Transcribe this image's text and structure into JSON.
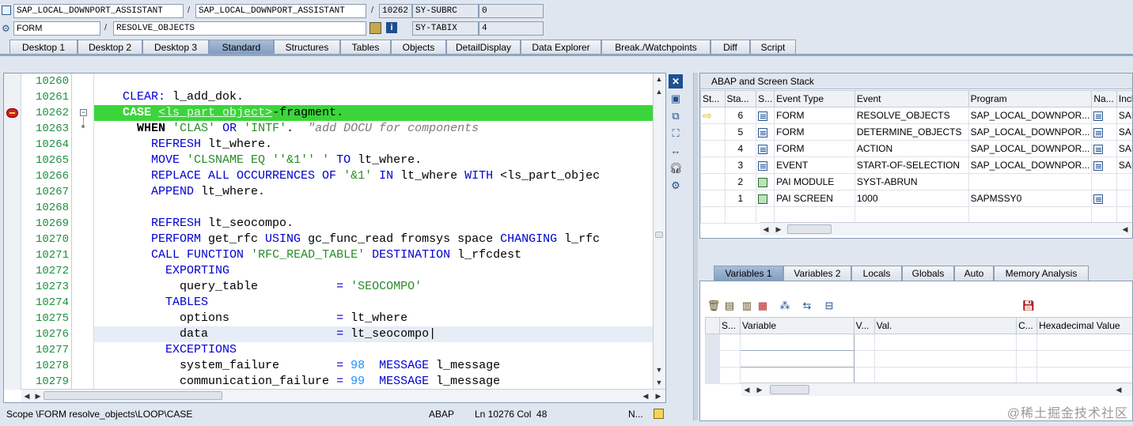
{
  "header": {
    "program1": "SAP_LOCAL_DOWNPORT_ASSISTANT",
    "program2": "SAP_LOCAL_DOWNPORT_ASSISTANT",
    "line_no": "10262",
    "subrc_label": "SY-SUBRC",
    "subrc_value": "0",
    "event_type": "FORM",
    "event_name": "RESOLVE_OBJECTS",
    "tabix_label": "SY-TABIX",
    "tabix_value": "4",
    "slash": "/"
  },
  "tabs": [
    "Desktop 1",
    "Desktop 2",
    "Desktop 3",
    "Standard",
    "Structures",
    "Tables",
    "Objects",
    "DetailDisplay",
    "Data Explorer",
    "Break./Watchpoints",
    "Diff",
    "Script"
  ],
  "active_tab": "Standard",
  "editor": {
    "line_numbers": [
      "10260",
      "10261",
      "10262",
      "10263",
      "10264",
      "10265",
      "10266",
      "10267",
      "10268",
      "10269",
      "10270",
      "10271",
      "10272",
      "10273",
      "10274",
      "10275",
      "10276",
      "10277",
      "10278",
      "10279"
    ],
    "status": {
      "scope": "Scope \\FORM resolve_objects\\LOOP\\CASE",
      "language": "ABAP",
      "position": "Ln 10276 Col  48",
      "mode": "N..."
    }
  },
  "stack": {
    "title": "ABAP and Screen Stack",
    "columns": [
      "St...",
      "Sta...",
      "S...",
      "Event Type",
      "Event",
      "Program",
      "Na...",
      "Inclu"
    ],
    "rows": [
      {
        "level": "6",
        "type": "FORM",
        "event": "RESOLVE_OBJECTS",
        "program": "SAP_LOCAL_DOWNPOR...",
        "incl": "SAP",
        "current": true,
        "icon": "program"
      },
      {
        "level": "5",
        "type": "FORM",
        "event": "DETERMINE_OBJECTS",
        "program": "SAP_LOCAL_DOWNPOR...",
        "incl": "SAP",
        "current": false,
        "icon": "program"
      },
      {
        "level": "4",
        "type": "FORM",
        "event": "ACTION",
        "program": "SAP_LOCAL_DOWNPOR...",
        "incl": "SAP",
        "current": false,
        "icon": "program"
      },
      {
        "level": "3",
        "type": "EVENT",
        "event": "START-OF-SELECTION",
        "program": "SAP_LOCAL_DOWNPOR...",
        "incl": "SAP",
        "current": false,
        "icon": "program"
      },
      {
        "level": "2",
        "type": "PAI MODULE",
        "event": "SYST-ABRUN",
        "program": "",
        "incl": "",
        "current": false,
        "icon": "screen"
      },
      {
        "level": "1",
        "type": "PAI SCREEN",
        "event": "1000",
        "program": "SAPMSSY0",
        "incl": "",
        "current": false,
        "icon": "screen"
      }
    ]
  },
  "var_tabs": [
    "Variables 1",
    "Variables 2",
    "Locals",
    "Globals",
    "Auto",
    "Memory Analysis"
  ],
  "active_var_tab": "Variables 1",
  "var_columns": [
    "S...",
    "Variable",
    "V...",
    "Val.",
    "C...",
    "Hexadecimal Value"
  ],
  "watermark": "@稀土掘金技术社区",
  "colors": {
    "highlight": "#3bd53b",
    "keyword": "#0000d0",
    "string": "#2a8b2a",
    "line_number": "#1f8f3f",
    "number": "#1e90ff"
  }
}
